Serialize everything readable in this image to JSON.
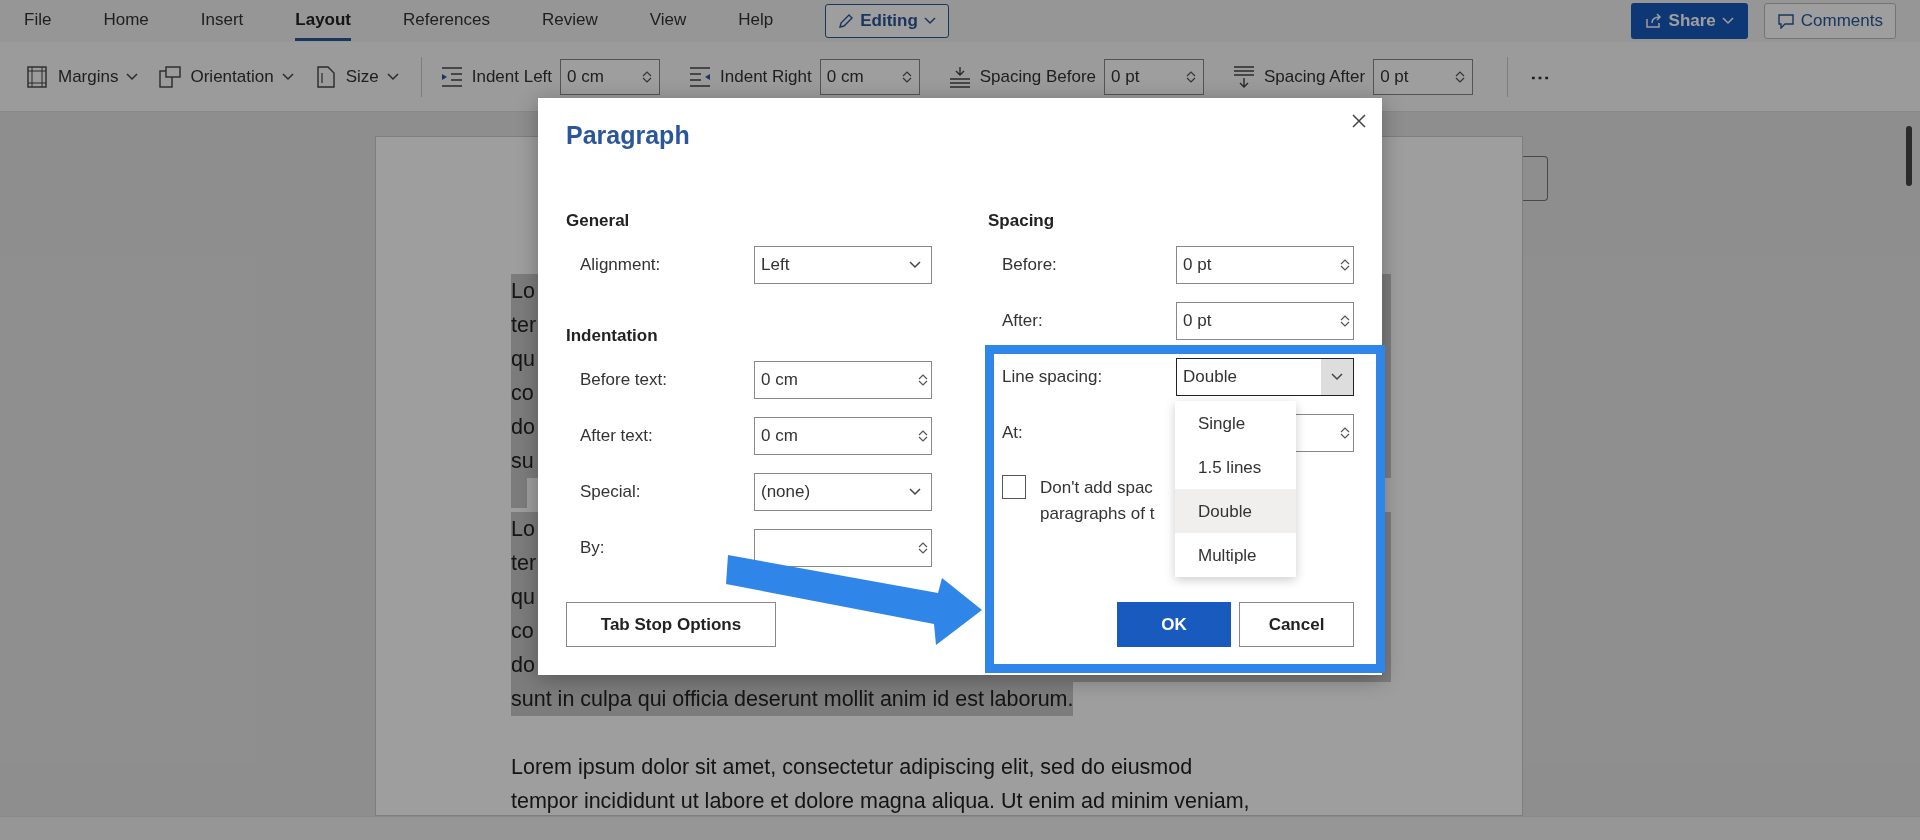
{
  "menu_tabs": [
    {
      "label": "File",
      "selected": false
    },
    {
      "label": "Home",
      "selected": false
    },
    {
      "label": "Insert",
      "selected": false
    },
    {
      "label": "Layout",
      "selected": true
    },
    {
      "label": "References",
      "selected": false
    },
    {
      "label": "Review",
      "selected": false
    },
    {
      "label": "View",
      "selected": false
    },
    {
      "label": "Help",
      "selected": false
    }
  ],
  "editing_button": {
    "label": "Editing"
  },
  "share_button": {
    "label": "Share"
  },
  "comments_button": {
    "label": "Comments"
  },
  "ribbon": [
    {
      "kind": "dropdown",
      "label": "Margins"
    },
    {
      "kind": "dropdown",
      "label": "Orientation"
    },
    {
      "kind": "dropdown",
      "label": "Size"
    },
    {
      "kind": "spin",
      "label": "Indent Left",
      "value": "0 cm"
    },
    {
      "kind": "spin",
      "label": "Indent Right",
      "value": "0 cm"
    },
    {
      "kind": "spin",
      "label": "Spacing Before",
      "value": "0 pt"
    },
    {
      "kind": "spin",
      "label": "Spacing After",
      "value": "0 pt"
    },
    {
      "kind": "more",
      "label": "⋯"
    }
  ],
  "document": {
    "lines": [
      {
        "text": "Lo",
        "highlighted": true
      },
      {
        "text": "ter",
        "highlighted": true
      },
      {
        "text": "qu",
        "highlighted": true
      },
      {
        "text": "co",
        "highlighted": true
      },
      {
        "text": "do",
        "highlighted": true
      },
      {
        "text": "su",
        "highlighted": true
      },
      {
        "highlighted": true
      },
      {
        "text": "Lo",
        "highlighted": true
      },
      {
        "text": "ter",
        "highlighted": true
      },
      {
        "text": "qu",
        "highlighted": true
      },
      {
        "text": "co",
        "highlighted": true
      },
      {
        "text": "do",
        "highlighted": true
      },
      {
        "text": "sunt in culpa qui officia deserunt mollit anim id est laborum.",
        "highlighted": true
      },
      {
        "text": "Lorem ipsum dolor sit amet, consectetur adipiscing elit, sed do eiusmod",
        "highlighted": false
      },
      {
        "text": "tempor incididunt ut labore et dolore magna aliqua. Ut enim ad minim veniam,",
        "highlighted": false
      }
    ]
  },
  "dialog": {
    "title": "Paragraph",
    "left": [
      {
        "kind": "heading",
        "text": "General"
      },
      {
        "kind": "select",
        "label": "Alignment:",
        "value": "Left"
      },
      {
        "kind": "heading",
        "text": "Indentation"
      },
      {
        "kind": "spin",
        "label": "Before text:",
        "value": "0 cm"
      },
      {
        "kind": "spin",
        "label": "After text:",
        "value": "0 cm"
      },
      {
        "kind": "select",
        "label": "Special:",
        "value": "(none)"
      },
      {
        "kind": "spin",
        "label": "By:"
      }
    ],
    "tab_stop_button": "Tab Stop Options",
    "right": [
      {
        "kind": "heading",
        "text": "Spacing"
      },
      {
        "kind": "spin",
        "label": "Before:",
        "value": "0 pt"
      },
      {
        "kind": "spin",
        "label": "After:",
        "value": "0 pt"
      },
      {
        "kind": "select",
        "label": "Line spacing:",
        "value": "Double",
        "open": true
      },
      {
        "kind": "spin",
        "label": "At:"
      },
      {
        "kind": "checkbox",
        "lines": [
          "Don't add spac",
          "paragraphs of t"
        ],
        "checked": false
      }
    ],
    "line_spacing_options": [
      {
        "label": "Single",
        "selected": false
      },
      {
        "label": "1.5 lines",
        "selected": false
      },
      {
        "label": "Double",
        "selected": true
      },
      {
        "label": "Multiple",
        "selected": false
      }
    ],
    "buttons": [
      {
        "label": "OK",
        "primary": true
      },
      {
        "label": "Cancel",
        "primary": false
      }
    ]
  }
}
